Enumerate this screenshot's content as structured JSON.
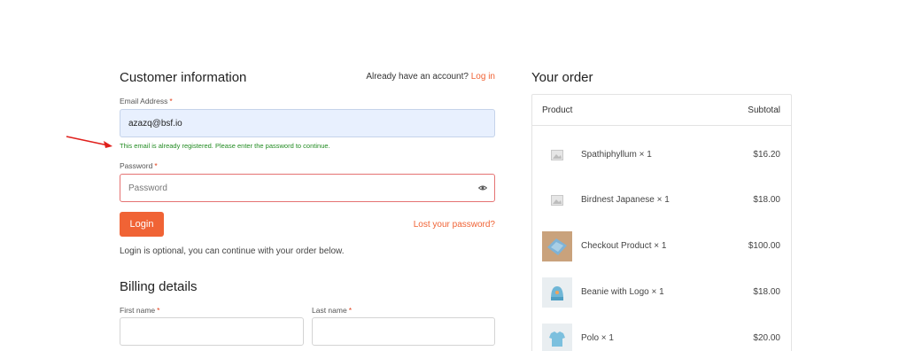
{
  "customer": {
    "title": "Customer information",
    "account_prompt": "Already have an account?",
    "login_link": "Log in",
    "email_label": "Email Address",
    "email_value": "azazq@bsf.io",
    "email_message": "This email is already registered. Please enter the password to continue.",
    "password_label": "Password",
    "password_placeholder": "Password",
    "login_button": "Login",
    "lost_password": "Lost your password?",
    "optional_note": "Login is optional, you can continue with your order below.",
    "required_mark": "*"
  },
  "billing": {
    "title": "Billing details",
    "first_name_label": "First name",
    "last_name_label": "Last name"
  },
  "order": {
    "title": "Your order",
    "col_product": "Product",
    "col_subtotal": "Subtotal",
    "items": [
      {
        "name": "Spathiphyllum × 1",
        "price": "$16.20",
        "thumb": "placeholder-image-icon"
      },
      {
        "name": "Birdnest Japanese × 1",
        "price": "$18.00",
        "thumb": "placeholder-image-icon"
      },
      {
        "name": "Checkout Product × 1",
        "price": "$100.00",
        "thumb": "product-photo"
      },
      {
        "name": "Beanie with Logo × 1",
        "price": "$18.00",
        "thumb": "beanie-photo"
      },
      {
        "name": "Polo × 1",
        "price": "$20.00",
        "thumb": "polo-photo"
      }
    ]
  },
  "colors": {
    "accent": "#f06335",
    "success": "#228b22",
    "required": "#e2401c",
    "annotation_arrow": "#e0201c"
  }
}
